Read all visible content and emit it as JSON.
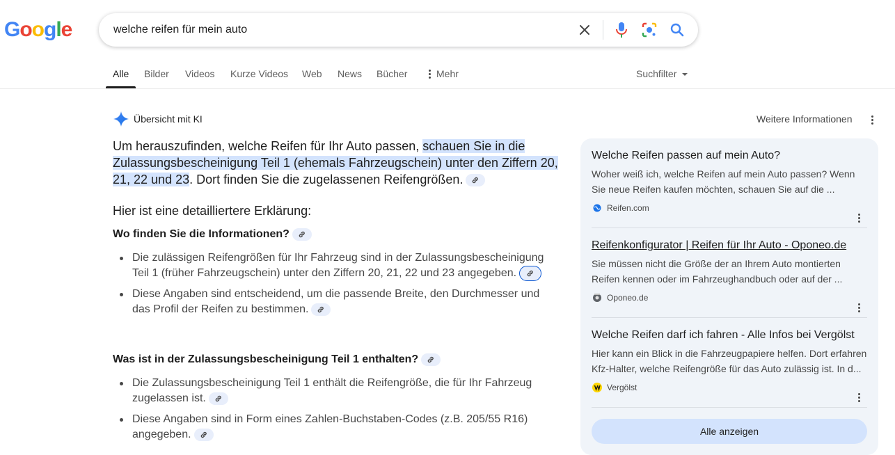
{
  "logo": {
    "letters": [
      "G",
      "o",
      "o",
      "g",
      "l",
      "e"
    ],
    "colors": [
      "#4285F4",
      "#EA4335",
      "#FBBC05",
      "#4285F4",
      "#34A853",
      "#EA4335"
    ]
  },
  "search": {
    "query": "welche reifen für mein auto"
  },
  "tabs": [
    {
      "label": "Alle"
    },
    {
      "label": "Bilder"
    },
    {
      "label": "Videos"
    },
    {
      "label": "Kurze Videos"
    },
    {
      "label": "Web"
    },
    {
      "label": "News"
    },
    {
      "label": "Bücher"
    },
    {
      "label": "Mehr"
    }
  ],
  "filter_label": "Suchfilter",
  "ai": {
    "title": "Übersicht mit KI",
    "more_info": "Weitere Informationen",
    "lead_a": "Um herauszufinden, welche Reifen für Ihr Auto passen, ",
    "lead_highlight": "schauen Sie in die Zulassungsbescheinigung Teil 1 (ehemals Fahrzeugschein) unter den Ziffern 20, 21, 22 und 23",
    "lead_b": ". Dort finden Sie die zugelassenen Reifengrößen.",
    "heading": "Hier ist eine detailliertere Erklärung:",
    "section1": {
      "title": "Wo finden Sie die Informationen?",
      "items": [
        "Die zulässigen Reifengrößen für Ihr Fahrzeug sind in der Zulassungsbescheinigung Teil 1 (früher Fahrzeugschein) unter den Ziffern 20, 21, 22 und 23 angegeben.",
        "Diese Angaben sind entscheidend, um die passende Breite, den Durchmesser und das Profil der Reifen zu bestimmen."
      ]
    },
    "section2": {
      "title": "Was ist in der Zulassungsbescheinigung Teil 1 enthalten?",
      "items": [
        "Die Zulassungsbescheinigung Teil 1 enthält die Reifengröße, die für Ihr Fahrzeug zugelassen ist.",
        "Diese Angaben sind in Form eines Zahlen-Buchstaben-Codes (z.B. 205/55 R16) angegeben."
      ]
    }
  },
  "sources": [
    {
      "title": "Welche Reifen passen auf mein Auto?",
      "desc": "Woher weiß ich, welche Reifen auf mein Auto passen? Wenn Sie neue Reifen kaufen möchten, schauen Sie auf die ...",
      "site": "Reifen.com"
    },
    {
      "title": "Reifenkonfigurator | Reifen für Ihr Auto - Oponeo.de",
      "desc": "Sie müssen nicht die Größe der an Ihrem Auto montierten Reifen kennen oder im Fahrzeughandbuch oder auf der ...",
      "site": "Oponeo.de"
    },
    {
      "title": "Welche Reifen darf ich fahren - Alle Infos bei Vergölst",
      "desc": "Hier kann ein Blick in die Fahrzeugpapiere helfen. Dort erfahren Kfz-Halter, welche Reifengröße für das Auto zulässig ist. In d...",
      "site": "Vergölst"
    }
  ],
  "show_all": "Alle anzeigen"
}
